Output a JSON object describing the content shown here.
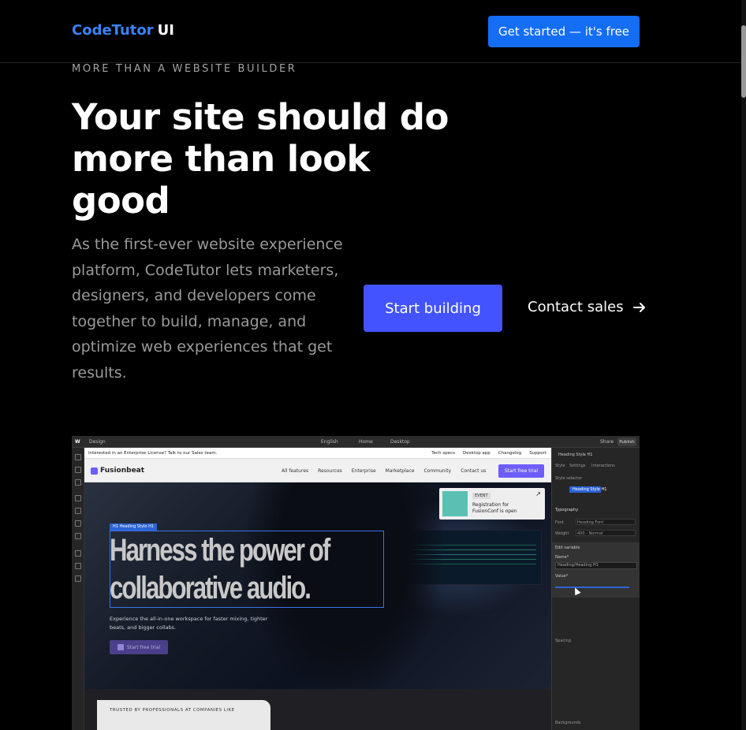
{
  "header": {
    "logo_brand": "CodeTutor",
    "logo_suffix": "UI",
    "cta_label": "Get started — it's free"
  },
  "hero": {
    "eyebrow": "MORE THAN A WEBSITE BUILDER",
    "title": "Your site should do more than look good",
    "description": "As the first-ever website experience platform, CodeTutor lets marketers, designers, and developers come together to build, manage, and optimize web experiences that get results.",
    "primary_button": "Start building",
    "secondary_link": "Contact sales"
  },
  "mock": {
    "topbar": {
      "mode": "Design",
      "locale": "English",
      "page": "Home",
      "breakpoint": "Desktop",
      "share": "Share",
      "publish": "Publish"
    },
    "promo_bar": {
      "text": "Interested in an Enterprise License? Talk to our Sales team.",
      "links": [
        "Tech specs",
        "Desktop app",
        "Changelog",
        "Support"
      ]
    },
    "site_nav": {
      "brand": "Fusionbeat",
      "links": [
        "All features",
        "Resources",
        "Enterprise",
        "Marketplace",
        "Community",
        "Contact us"
      ],
      "cta": "Start free trial"
    },
    "event_card": {
      "tag": "EVENT",
      "text": "Registration for FusionConf is open"
    },
    "selection_label": "H1 Heading Style H1",
    "headline": "Harness the power of collaborative audio.",
    "subtext": "Experience the all-in-one workspace for faster mixing, tighter beats, and bigger collabs.",
    "hero_button": "Start free trial",
    "trusted": "TRUSTED BY PROFESSIONALS AT COMPANIES LIKE",
    "right_panel": {
      "element": "Heading Style H1",
      "tabs": [
        "Style",
        "Settings",
        "Interactions"
      ],
      "style_selector": "Style selector",
      "selected_class": "Heading Style H1",
      "typography": "Typography",
      "font_label": "Font",
      "font_value": "Heading Font",
      "weight_label": "Weight",
      "weight_value": "400 - Normal",
      "edit_variable": "Edit variable",
      "name_label": "Name*",
      "name_value": "Heading/Heading H1",
      "value_label": "Value*",
      "spacing": "Spacing",
      "decorations": "Backgrounds"
    }
  }
}
